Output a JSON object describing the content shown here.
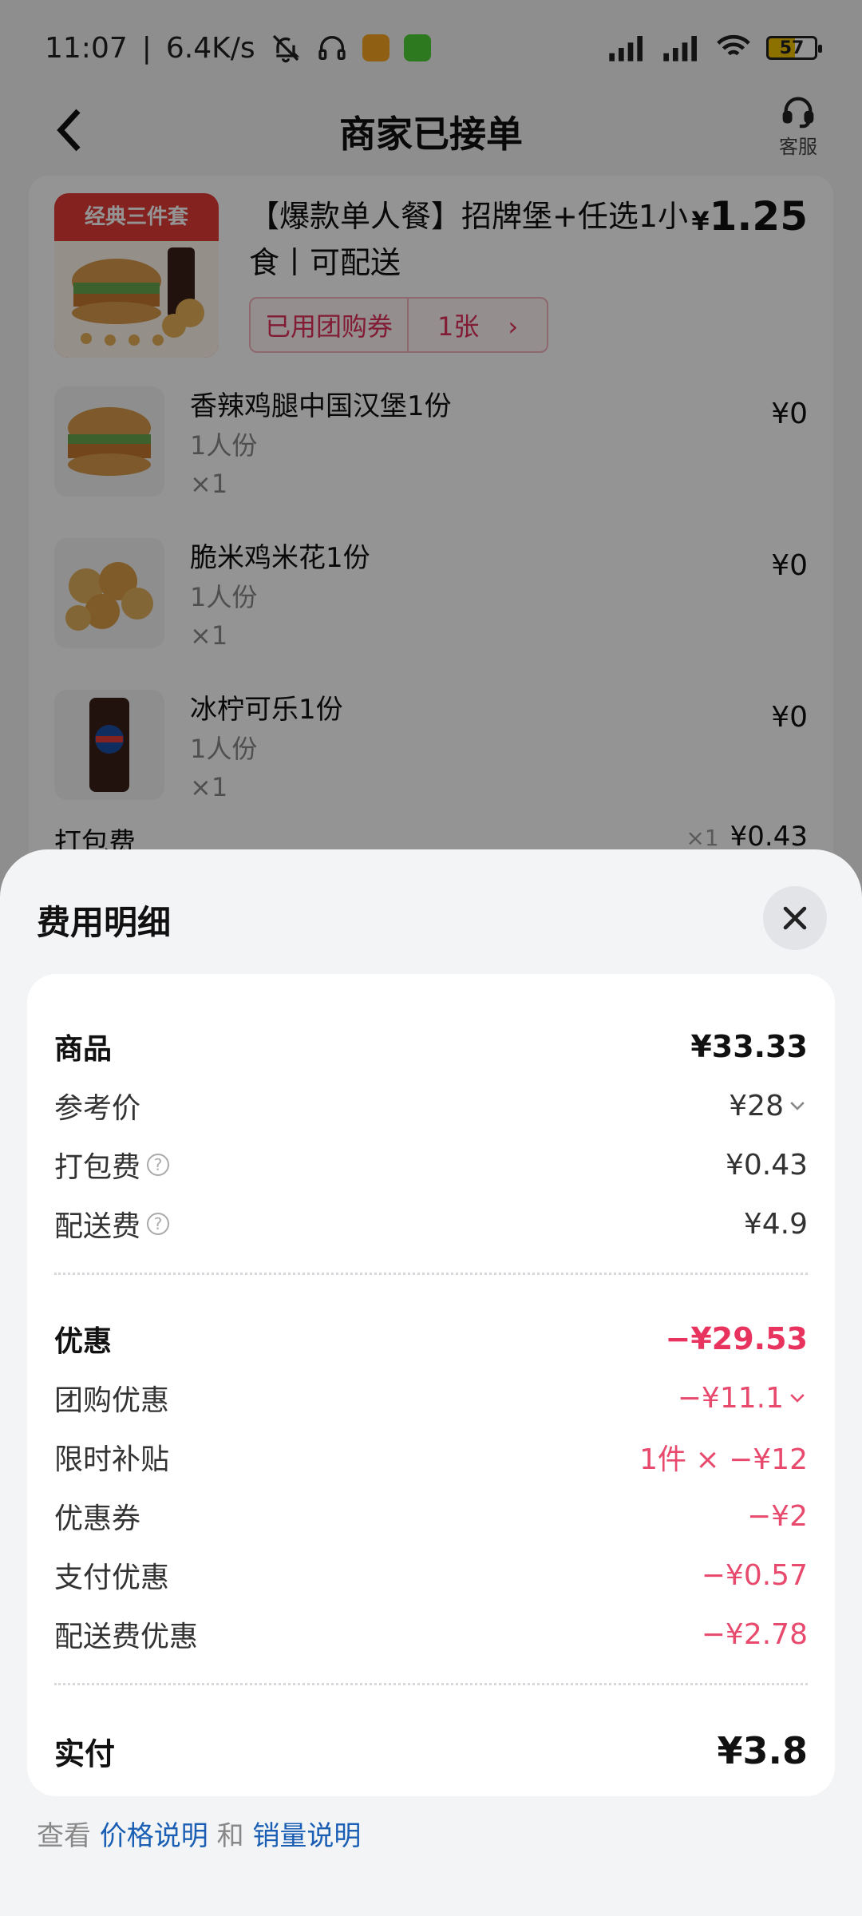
{
  "status_bar": {
    "time": "11:07",
    "network_speed": "6.4K/s",
    "battery": "57",
    "icons": [
      "mute-icon",
      "headphone-icon",
      "message-app-icon",
      "chat-app-icon",
      "signal-icon",
      "wifi-icon",
      "battery-icon"
    ]
  },
  "header": {
    "title": "商家已接单",
    "service_label": "客服"
  },
  "order": {
    "main_item": {
      "image_badge": "经典三件套",
      "name": "【爆款单人餐】招牌堡+任选1小食丨可配送",
      "price_symbol": "¥",
      "price": "1.25",
      "coupon_label": "已用团购券",
      "coupon_count": "1张",
      "coupon_arrow": "›"
    },
    "sub_items": [
      {
        "name": "香辣鸡腿中国汉堡1份",
        "portion": "1人份",
        "qty": "×1",
        "price": "¥0"
      },
      {
        "name": "脆米鸡米花1份",
        "portion": "1人份",
        "qty": "×1",
        "price": "¥0"
      },
      {
        "name": "冰柠可乐1份",
        "portion": "1人份",
        "qty": "×1",
        "price": "¥0"
      }
    ],
    "packing": {
      "label": "打包费",
      "qty": "×1",
      "price": "¥0.43"
    }
  },
  "sheet": {
    "title": "费用明细",
    "goods": {
      "label": "商品",
      "value": "¥33.33"
    },
    "ref_price": {
      "label": "参考价",
      "value": "¥28"
    },
    "packing_fee": {
      "label": "打包费",
      "value": "¥0.43"
    },
    "delivery_fee": {
      "label": "配送费",
      "value": "¥4.9"
    },
    "discount": {
      "label": "优惠",
      "value": "−¥29.53"
    },
    "group_buy": {
      "label": "团购优惠",
      "value": "−¥11.1"
    },
    "subsidy": {
      "label": "限时补贴",
      "value": "1件 × −¥12"
    },
    "coupon": {
      "label": "优惠券",
      "value": "−¥2"
    },
    "pay_discount": {
      "label": "支付优惠",
      "value": "−¥0.57"
    },
    "delivery_discount": {
      "label": "配送费优惠",
      "value": "−¥2.78"
    },
    "paid": {
      "label": "实付",
      "value": "¥3.8"
    },
    "footer": {
      "prefix": "查看",
      "price_link": "价格说明",
      "and": "和",
      "sales_link": "销量说明"
    }
  },
  "colors": {
    "discount": "#e8335f",
    "link": "#1a5fb4",
    "overlay": "rgba(0,0,0,0.42)"
  }
}
